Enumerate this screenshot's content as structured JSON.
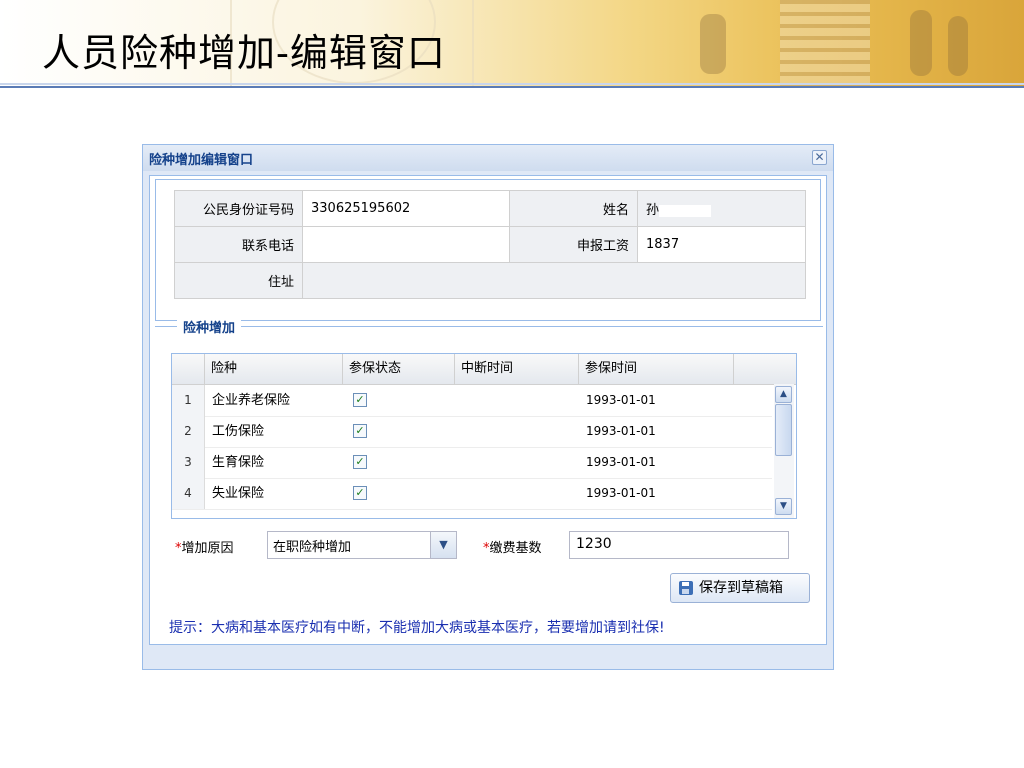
{
  "slide": {
    "title": "人员险种增加-编辑窗口"
  },
  "window": {
    "title": "险种增加编辑窗口",
    "close_icon": "close-icon"
  },
  "info": {
    "id_label": "公民身份证号码",
    "id_value": "330625195602",
    "name_label": "姓名",
    "name_value": "孙",
    "phone_label": "联系电话",
    "phone_value": "",
    "salary_label": "申报工资",
    "salary_value": "1837",
    "address_label": "住址",
    "address_value": ""
  },
  "section": {
    "legend": "险种增加"
  },
  "grid": {
    "columns": [
      "险种",
      "参保状态",
      "中断时间",
      "参保时间"
    ],
    "rows": [
      {
        "num": "1",
        "type": "企业养老保险",
        "checked": true,
        "break_time": "",
        "join_time": "1993-01-01"
      },
      {
        "num": "2",
        "type": "工伤保险",
        "checked": true,
        "break_time": "",
        "join_time": "1993-01-01"
      },
      {
        "num": "3",
        "type": "生育保险",
        "checked": true,
        "break_time": "",
        "join_time": "1993-01-01"
      },
      {
        "num": "4",
        "type": "失业保险",
        "checked": true,
        "break_time": "",
        "join_time": "1993-01-01"
      }
    ]
  },
  "form": {
    "required_mark": "*",
    "reason_label": "增加原因",
    "reason_value": "在职险种增加",
    "base_label": "缴费基数",
    "base_value": "1230"
  },
  "buttons": {
    "save_label": "保存到草稿箱"
  },
  "tip": "提示：大病和基本医疗如有中断，不能增加大病或基本医疗，若要增加请到社保!"
}
